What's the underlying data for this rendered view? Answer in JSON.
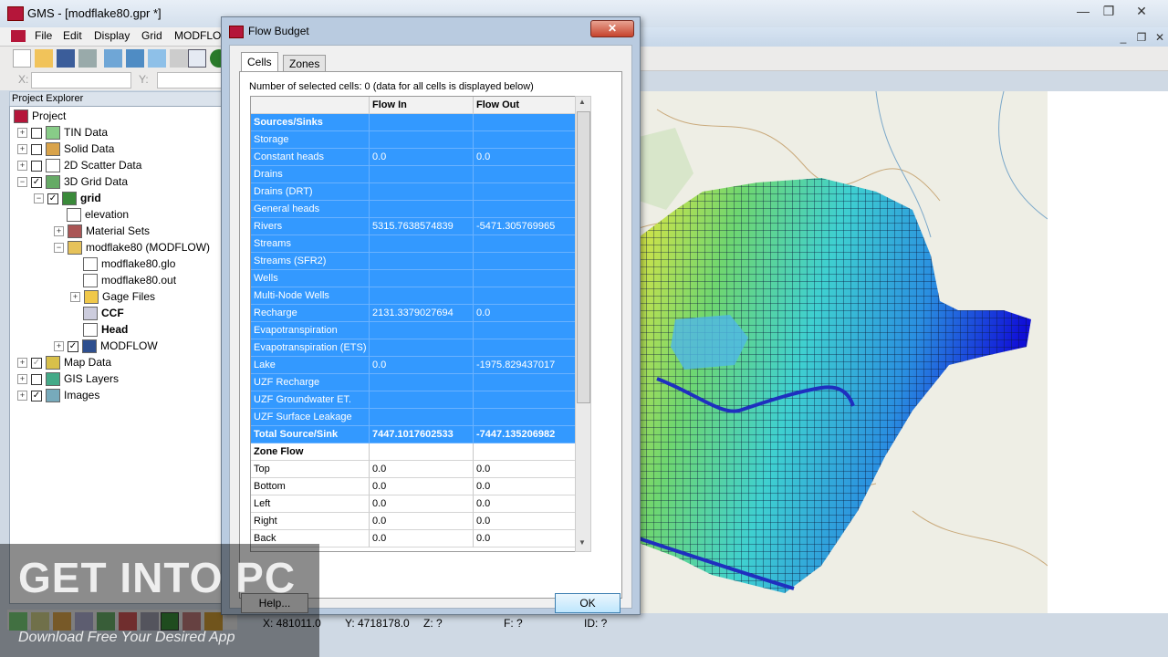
{
  "window": {
    "title": "GMS - [modflake80.gpr *]",
    "min": "—",
    "max": "❐",
    "close": "✕"
  },
  "menu": [
    "File",
    "Edit",
    "Display",
    "Grid",
    "MODFLOW"
  ],
  "coords": {
    "x_label": "X:",
    "y_label": "Y:"
  },
  "explorer": {
    "header": "Project Explorer",
    "items": [
      {
        "label": "Project",
        "indent": 0
      },
      {
        "label": "TIN Data",
        "indent": 1
      },
      {
        "label": "Solid Data",
        "indent": 1
      },
      {
        "label": "2D Scatter Data",
        "indent": 1
      },
      {
        "label": "3D Grid Data",
        "indent": 1
      },
      {
        "label": "grid",
        "indent": 2
      },
      {
        "label": "elevation",
        "indent": 3
      },
      {
        "label": "Material Sets",
        "indent": 3
      },
      {
        "label": "modflake80 (MODFLOW)",
        "indent": 3
      },
      {
        "label": "modflake80.glo",
        "indent": 4
      },
      {
        "label": "modflake80.out",
        "indent": 4
      },
      {
        "label": "Gage Files",
        "indent": 4
      },
      {
        "label": "CCF",
        "indent": 4
      },
      {
        "label": "Head",
        "indent": 4
      },
      {
        "label": "MODFLOW",
        "indent": 3
      },
      {
        "label": "Map Data",
        "indent": 1
      },
      {
        "label": "GIS Layers",
        "indent": 1
      },
      {
        "label": "Images",
        "indent": 1
      }
    ]
  },
  "dialog": {
    "title": "Flow Budget",
    "close": "✕",
    "tabs": [
      "Cells",
      "Zones"
    ],
    "selected_cells": "Number of selected cells:  0 (data for all cells is displayed below)",
    "columns": [
      "",
      "Flow In",
      "Flow Out"
    ],
    "rows": [
      [
        "Sources/Sinks",
        "",
        ""
      ],
      [
        "Storage",
        "",
        ""
      ],
      [
        "Constant heads",
        "0.0",
        "0.0"
      ],
      [
        "Drains",
        "",
        ""
      ],
      [
        "Drains (DRT)",
        "",
        ""
      ],
      [
        "General heads",
        "",
        ""
      ],
      [
        "Rivers",
        "5315.7638574839",
        "-5471.305769965"
      ],
      [
        "Streams",
        "",
        ""
      ],
      [
        "Streams (SFR2)",
        "",
        ""
      ],
      [
        "Wells",
        "",
        ""
      ],
      [
        "Multi-Node Wells",
        "",
        ""
      ],
      [
        "Recharge",
        "2131.3379027694",
        "0.0"
      ],
      [
        "Evapotranspiration",
        "",
        ""
      ],
      [
        "Evapotranspiration (ETS)",
        "",
        ""
      ],
      [
        "Lake",
        "0.0",
        "-1975.829437017"
      ],
      [
        "UZF Recharge",
        "",
        ""
      ],
      [
        "UZF Groundwater ET.",
        "",
        ""
      ],
      [
        "UZF Surface Leakage",
        "",
        ""
      ],
      [
        "Total Source/Sink",
        "7447.1017602533",
        "-7447.135206982"
      ],
      [
        "Zone Flow",
        "",
        ""
      ],
      [
        "Top",
        "0.0",
        "0.0"
      ],
      [
        "Bottom",
        "0.0",
        "0.0"
      ],
      [
        "Left",
        "0.0",
        "0.0"
      ],
      [
        "Right",
        "0.0",
        "0.0"
      ],
      [
        "Back",
        "0.0",
        "0.0"
      ]
    ],
    "help": "Help...",
    "ok": "OK"
  },
  "status": {
    "x": "X: 481011.0",
    "y": "Y: 4718178.0",
    "z": "Z: ?",
    "f": "F: ?",
    "id": "ID: ?"
  },
  "watermark": {
    "main": "GET INTO PC",
    "sub": "Download Free Your Desired App"
  }
}
